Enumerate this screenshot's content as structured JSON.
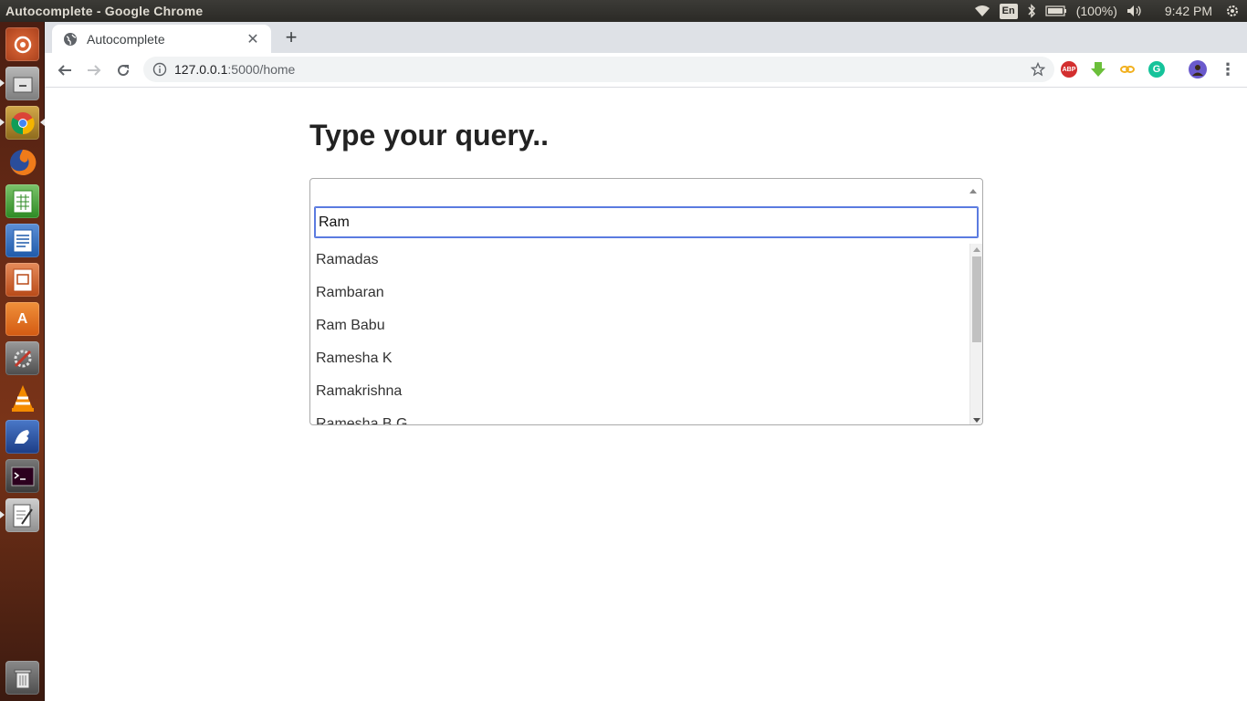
{
  "system": {
    "window_title": "Autocomplete - Google Chrome",
    "lang": "En",
    "battery": "(100%)",
    "clock": "9:42 PM"
  },
  "launcher": {
    "apps": [
      "ubuntu-dash",
      "files",
      "chrome",
      "firefox",
      "libreoffice-calc",
      "libreoffice-writer",
      "libreoffice-impress",
      "software-center",
      "system-settings",
      "vlc",
      "pidgin",
      "terminal",
      "text-editor",
      "trash"
    ]
  },
  "browser": {
    "tab_title": "Autocomplete",
    "url_host": "127.0.0.1",
    "url_path": ":5000/home",
    "extensions": [
      "ABP",
      "download-icon",
      "link-icon",
      "grammarly-icon"
    ]
  },
  "page": {
    "heading": "Type your query..",
    "select_value": "",
    "search_value": "Ram",
    "results": [
      "Ramadas",
      "Rambaran",
      "Ram Babu",
      "Ramesha K",
      "Ramakrishna",
      "Ramesha B G"
    ]
  },
  "colors": {
    "focus_border": "#5b7be0",
    "panel": "#3c3b37",
    "tabstrip": "#dee1e6"
  }
}
